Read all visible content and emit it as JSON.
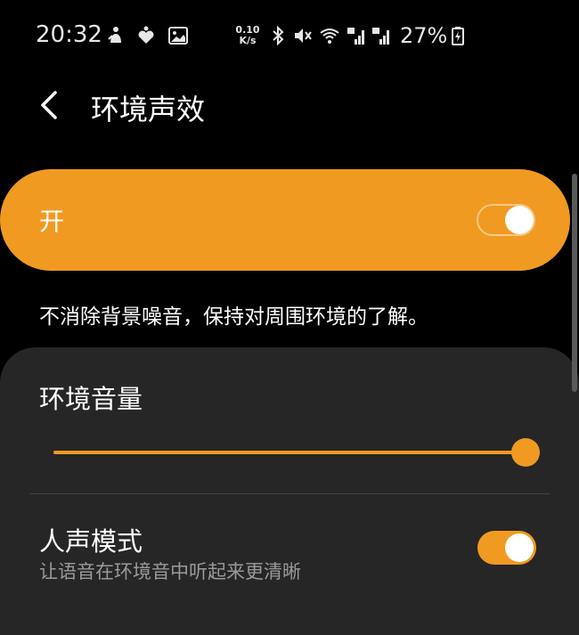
{
  "status_bar": {
    "time": "20:32",
    "net_speed_value": "0.10",
    "net_speed_unit": "K/s",
    "battery_percent": "27%",
    "icons": [
      "notification-icon",
      "heart-icon",
      "image-icon",
      "bluetooth-icon",
      "mute-icon",
      "wifi-icon",
      "signal-4g-icon",
      "signal-4g-icon",
      "battery-charging-icon"
    ]
  },
  "header": {
    "title": "环境声效",
    "back_icon": "chevron-left-icon"
  },
  "master_switch": {
    "label": "开",
    "enabled": true
  },
  "description": "不消除背景噪音，保持对周围环境的了解。",
  "settings": {
    "volume": {
      "label": "环境音量",
      "value": 1.0
    },
    "voice_mode": {
      "label": "人声模式",
      "subtitle": "让语音在环境音中听起来更清晰",
      "enabled": true
    }
  },
  "colors": {
    "accent": "#f09a22",
    "background": "#000000",
    "panel": "#262626",
    "secondary_text": "#9a9a9a"
  }
}
